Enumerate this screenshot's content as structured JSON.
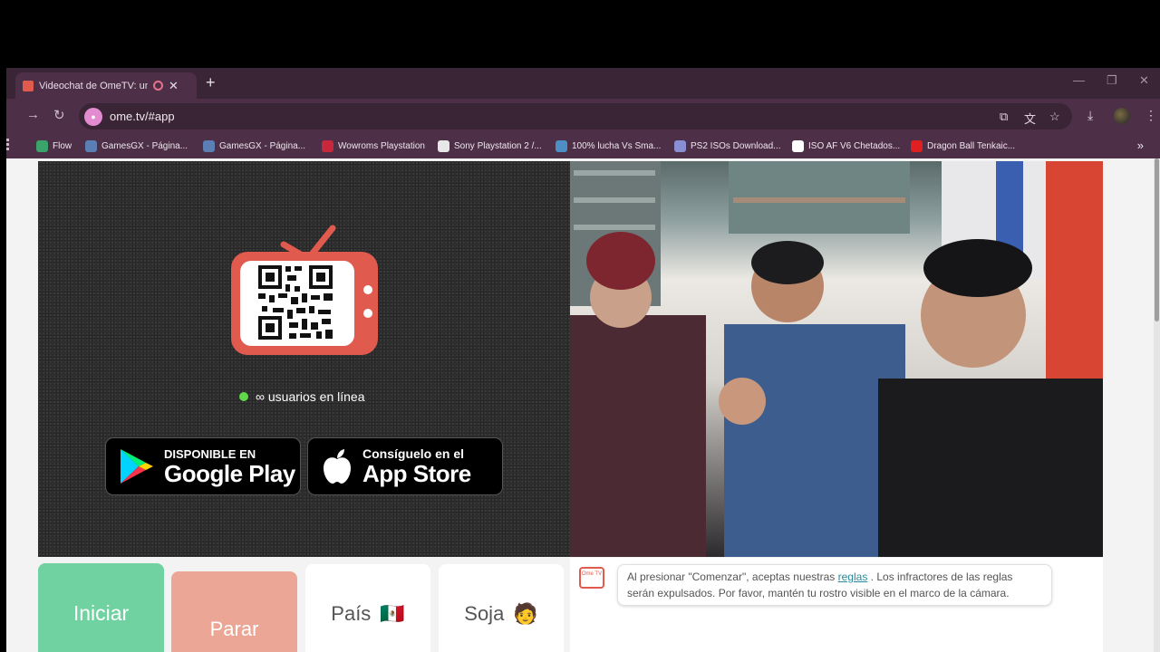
{
  "browser": {
    "tab_title": "Videochat de OmeTV: una",
    "url": "ome.tv/#app",
    "bookmarks": [
      {
        "label": "Flow",
        "icon_color": "#3ba36b"
      },
      {
        "label": "GamesGX - Página...",
        "icon_color": "#5b7fb5"
      },
      {
        "label": "GamesGX - Página...",
        "icon_color": "#5b7fb5"
      },
      {
        "label": "Wowroms Playstation",
        "icon_color": "#c8283c"
      },
      {
        "label": "Sony Playstation 2 /...",
        "icon_color": "#e8e8e8"
      },
      {
        "label": "100% lucha Vs Sma...",
        "icon_color": "#4b8fc4"
      },
      {
        "label": "PS2 ISOs Download...",
        "icon_color": "#8a8fd4"
      },
      {
        "label": "ISO AF V6 Chetados...",
        "icon_color": "#ffffff"
      },
      {
        "label": "Dragon Ball Tenkaic...",
        "icon_color": "#e02020"
      }
    ]
  },
  "left_panel": {
    "online_text": "∞ usuarios en línea",
    "google_play": {
      "small": "DISPONIBLE EN",
      "big": "Google Play"
    },
    "app_store": {
      "small": "Consíguelo en el",
      "big": "App Store"
    }
  },
  "controls": {
    "start_label": "Iniciar",
    "stop_label": "Parar",
    "country_label": "País",
    "country_flag": "🇲🇽",
    "gender_label": "Soja",
    "gender_emoji": "🧑"
  },
  "chat": {
    "logo_text": "Ome TV",
    "message_before": "Al presionar \"Comenzar\", aceptas nuestras",
    "message_link": "reglas",
    "message_after": ". Los infractores de las reglas serán expulsados. Por favor, mantén tu rostro visible en el marco de la cámara."
  },
  "colors": {
    "start": "#6fd2a0",
    "stop": "#eba696",
    "accent": "#e05a4e"
  }
}
